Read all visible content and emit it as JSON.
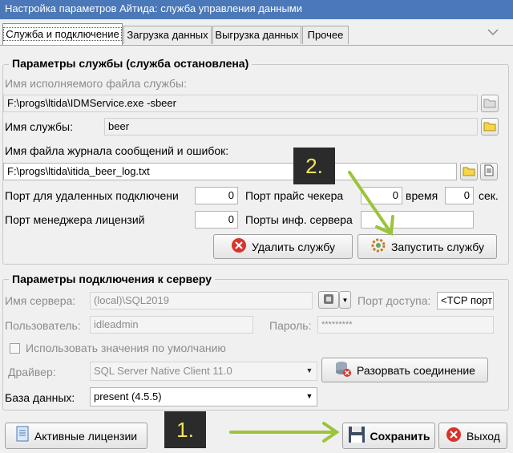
{
  "window": {
    "title": "Настройка параметров Айтида: служба управления данными"
  },
  "tabs": [
    {
      "label": "Служба и подключение"
    },
    {
      "label": "Загрузка данных"
    },
    {
      "label": "Выгрузка данных"
    },
    {
      "label": "Прочее"
    }
  ],
  "service": {
    "legend": "Параметры службы (служба остановлена)",
    "exe_label": "Имя исполняемого файла службы:",
    "exe_value": "F:\\progs\\ltida\\IDMService.exe -sbeer",
    "name_label": "Имя службы:",
    "name_value": "beer",
    "log_label": "Имя файла журнала сообщений и ошибок:",
    "log_value": "F:\\progs\\ltida\\itida_beer_log.txt",
    "remote_port_label": "Порт для удаленных подключени",
    "remote_port_value": "0",
    "price_port_label": "Порт прайс чекера",
    "price_port_value": "0",
    "time_label": "время",
    "time_value": "0",
    "sec_label": "сек.",
    "license_port_label": "Порт менеджера лицензий",
    "license_port_value": "0",
    "info_port_label": "Порты инф. сервера",
    "info_port_value": "",
    "delete_button": "Удалить службу",
    "start_button": "Запустить службу"
  },
  "connection": {
    "legend": "Параметры подключения к серверу",
    "server_label": "Имя сервера:",
    "server_value": "(local)\\SQL2019",
    "access_port_label": "Порт доступа:",
    "access_port_value": "<TCP порт",
    "user_label": "Пользователь:",
    "user_value": "idleadmin",
    "password_label": "Пароль:",
    "password_value": "*********",
    "defaults_label": "Использовать значения по умолчанию",
    "driver_label": "Драйвер:",
    "driver_value": "SQL Server Native Client 11.0",
    "disconnect_button": "Разорвать соединение",
    "db_label": "База данных:",
    "db_value": "present (4.5.5)"
  },
  "footer": {
    "licenses_button": "Активные лицензии",
    "save_button": "Сохранить",
    "exit_button": "Выход"
  },
  "annotations": {
    "step1": "1.",
    "step2": "2."
  },
  "colors": {
    "titlebar": "#4a78b8",
    "arrow": "#9cc43a",
    "step_bg": "#2b2b2b",
    "step_text": "#f2e35a"
  }
}
